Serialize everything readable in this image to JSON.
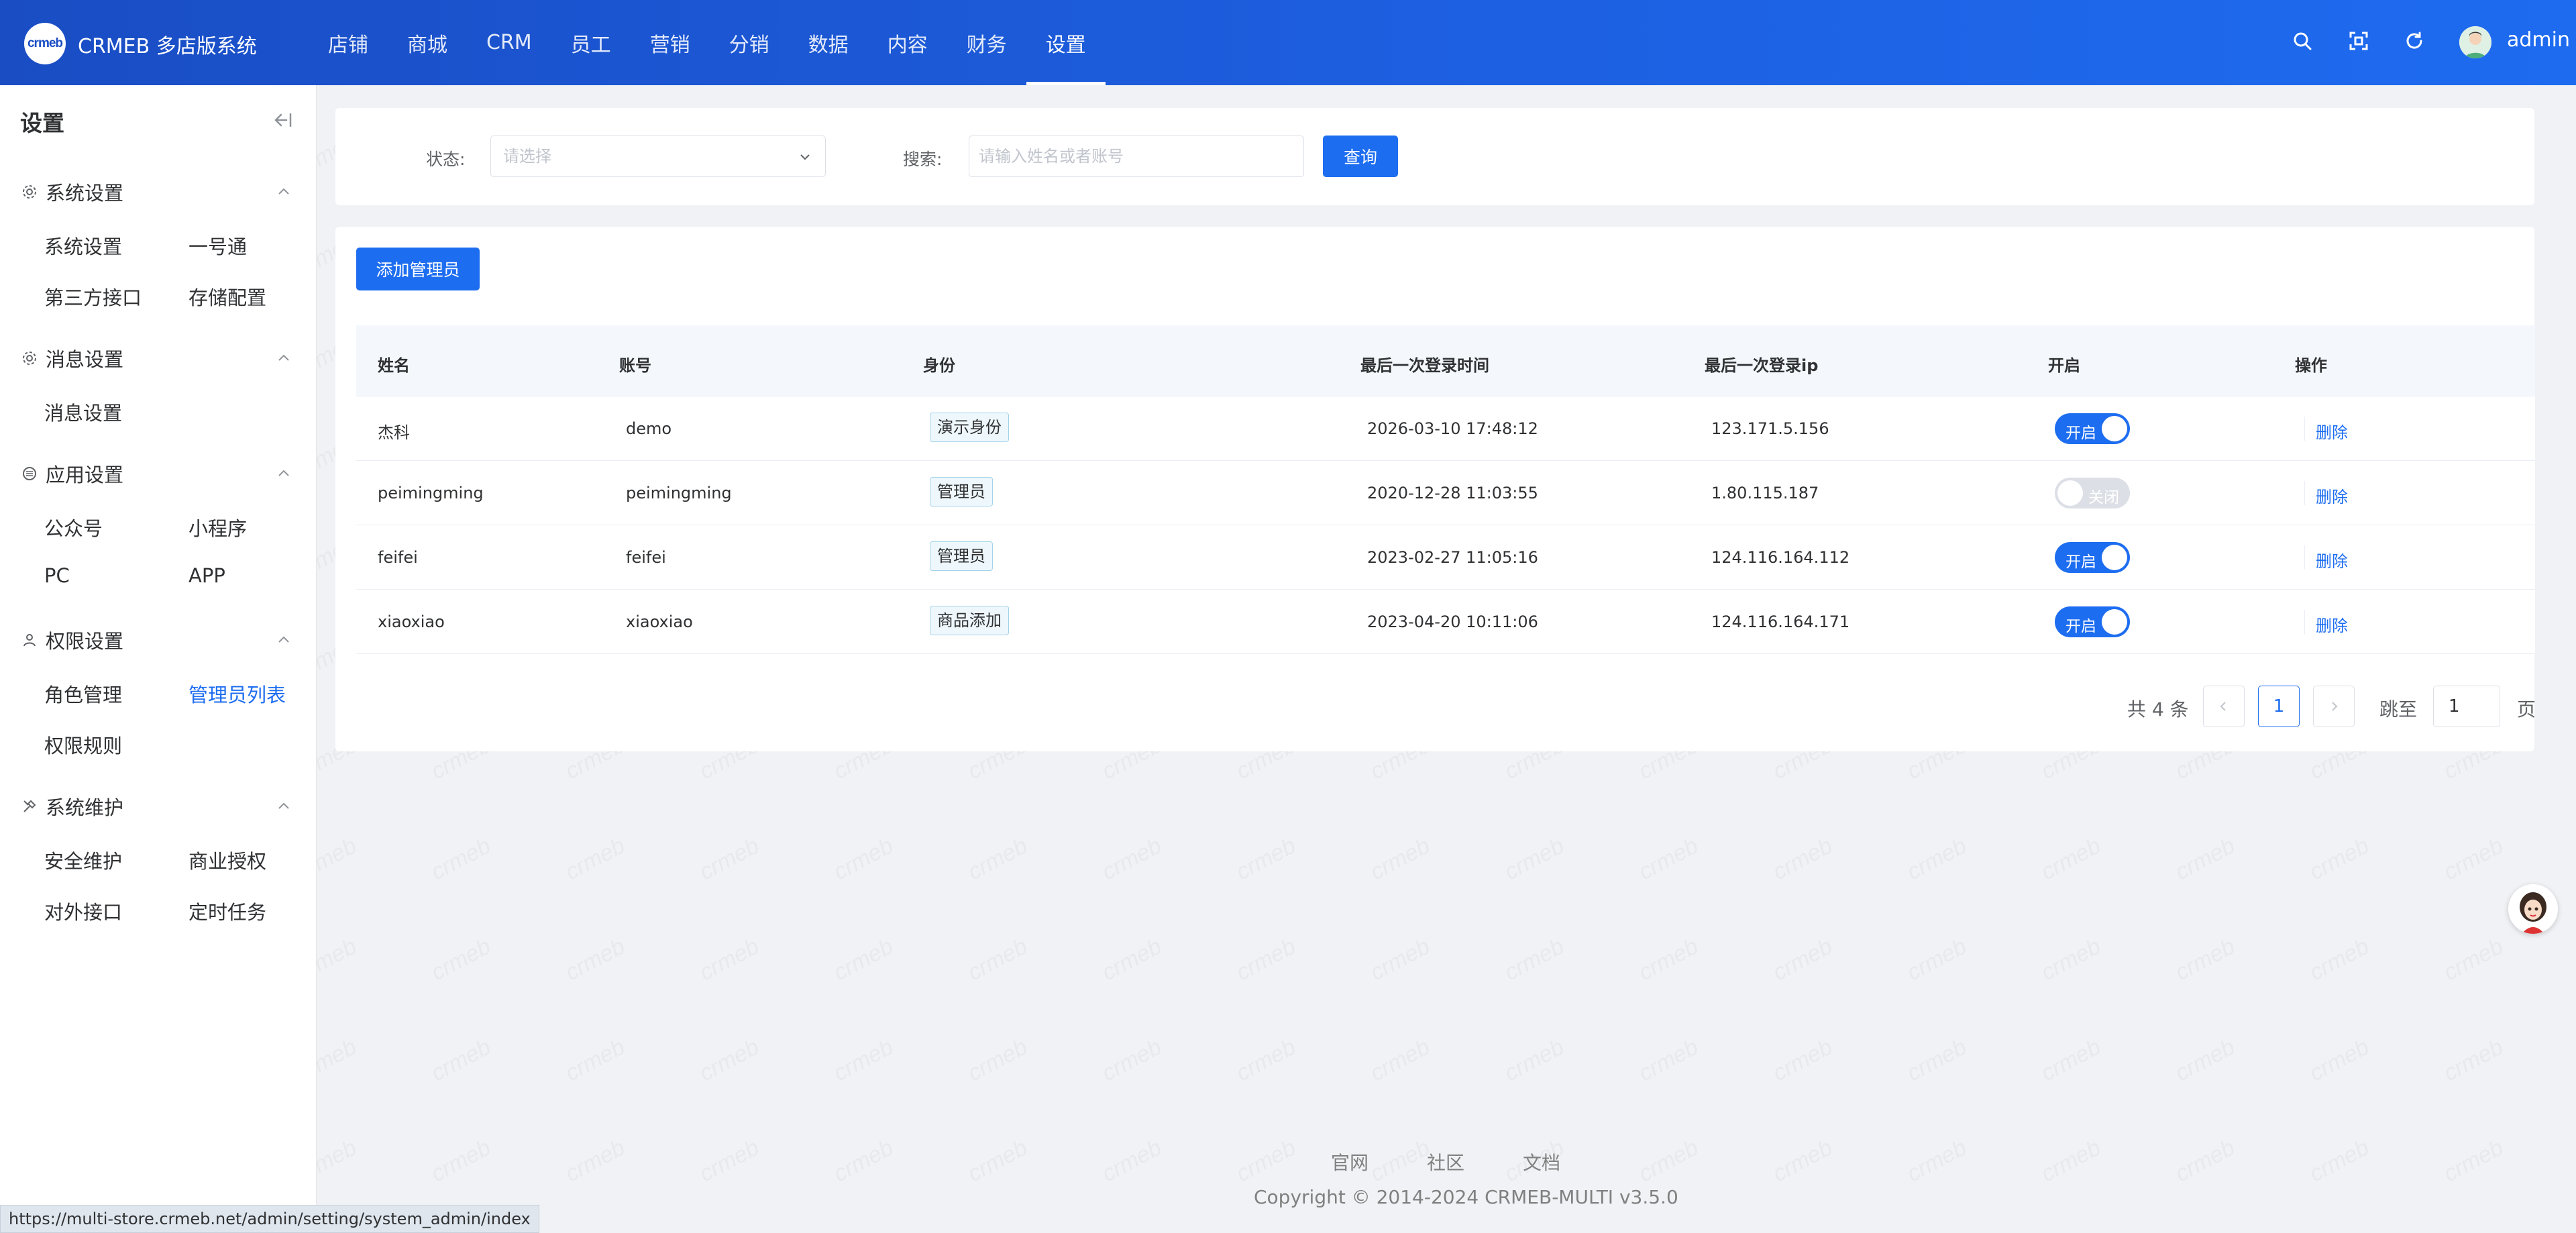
{
  "header": {
    "logo_text": "crmeb",
    "app_title": "CRMEB 多店版系统",
    "nav": [
      "店铺",
      "商城",
      "CRM",
      "员工",
      "营销",
      "分销",
      "数据",
      "内容",
      "财务",
      "设置"
    ],
    "active_nav": "设置",
    "user": "admin",
    "icons": [
      "search-icon",
      "fullscreen-icon",
      "refresh-icon"
    ]
  },
  "sidebar": {
    "title": "设置",
    "groups": [
      {
        "title": "系统设置",
        "icon": "gear-icon",
        "items": [
          "系统设置",
          "一号通",
          "第三方接口",
          "存储配置"
        ]
      },
      {
        "title": "消息设置",
        "icon": "gear-icon",
        "items": [
          "消息设置"
        ]
      },
      {
        "title": "应用设置",
        "icon": "app-icon",
        "items": [
          "公众号",
          "小程序",
          "PC",
          "APP"
        ]
      },
      {
        "title": "权限设置",
        "icon": "user-icon",
        "items": [
          "角色管理",
          "管理员列表",
          "权限规则"
        ]
      },
      {
        "title": "系统维护",
        "icon": "tools-icon",
        "items": [
          "安全维护",
          "商业授权",
          "对外接口",
          "定时任务"
        ]
      }
    ],
    "active_item": "管理员列表"
  },
  "filter": {
    "status_label": "状态:",
    "status_placeholder": "请选择",
    "search_label": "搜索:",
    "search_placeholder": "请输入姓名或者账号",
    "query_button": "查询"
  },
  "add_button": "添加管理员",
  "table": {
    "columns": [
      "姓名",
      "账号",
      "身份",
      "最后一次登录时间",
      "最后一次登录ip",
      "开启",
      "操作"
    ],
    "rows": [
      {
        "name": "杰科",
        "account": "demo",
        "role": "演示身份",
        "last_login": "2026-03-10 17:48:12",
        "ip": "123.171.5.156",
        "enabled": true,
        "switch_text": "开启",
        "action": "删除"
      },
      {
        "name": "peimingming",
        "account": "peimingming",
        "role": "管理员",
        "last_login": "2020-12-28 11:03:55",
        "ip": "1.80.115.187",
        "enabled": false,
        "switch_text": "关闭",
        "action": "删除"
      },
      {
        "name": "feifei",
        "account": "feifei",
        "role": "管理员",
        "last_login": "2023-02-27 11:05:16",
        "ip": "124.116.164.112",
        "enabled": true,
        "switch_text": "开启",
        "action": "删除"
      },
      {
        "name": "xiaoxiao",
        "account": "xiaoxiao",
        "role": "商品添加",
        "last_login": "2023-04-20 10:11:06",
        "ip": "124.116.164.171",
        "enabled": true,
        "switch_text": "开启",
        "action": "删除"
      }
    ]
  },
  "pagination": {
    "total_text": "共 4 条",
    "current_page": "1",
    "jump_label": "跳至",
    "jump_value": "1",
    "page_suffix": "页"
  },
  "footer": {
    "links": [
      "官网",
      "社区",
      "文档"
    ],
    "copyright": "Copyright © 2014-2024 CRMEB-MULTI v3.5.0"
  },
  "status_bar_url": "https://multi-store.crmeb.net/admin/setting/system_admin/index",
  "watermark_text": "crmeb",
  "colors": {
    "primary": "#1d6df0",
    "header_start": "#1a4dc4",
    "header_end": "#1e6bf0",
    "background": "#f0f2f5"
  }
}
